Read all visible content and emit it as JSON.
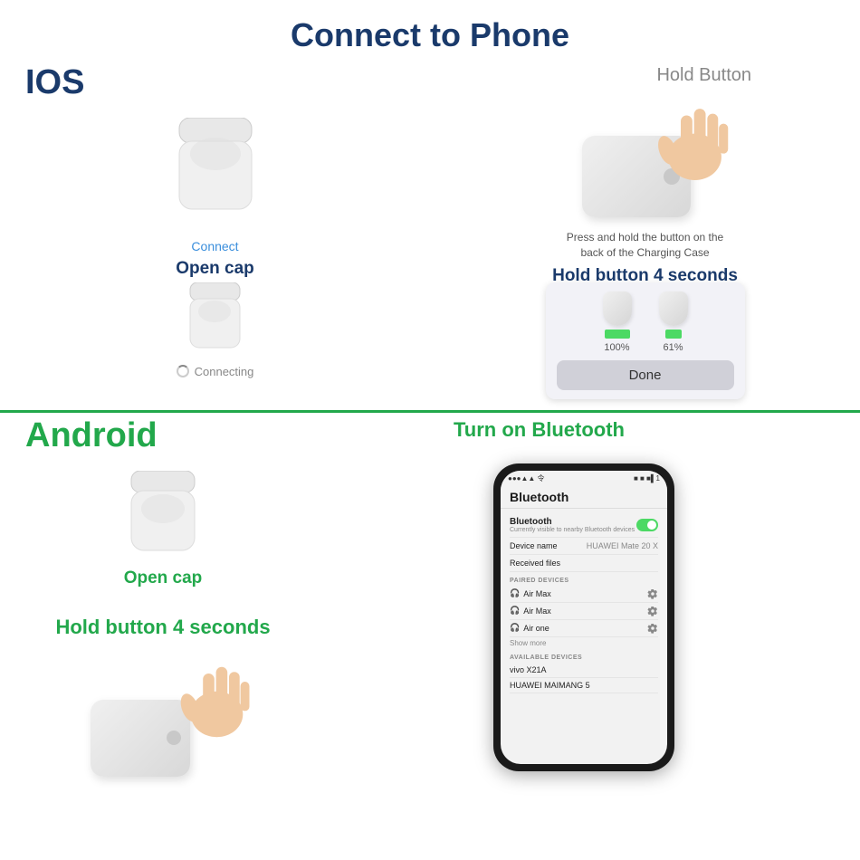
{
  "page": {
    "title": "Connect to Phone",
    "ios_label": "IOS",
    "android_label": "Android",
    "hold_button_label": "Hold Button",
    "turn_on_bt_label": "Turn on Bluetooth"
  },
  "ios": {
    "left_step": {
      "connect_label": "Connect",
      "step_label": "Open cap"
    },
    "right_step": {
      "press_description": "Press and hold the button on the\nback of the Charging Case",
      "step_label": "Hold button 4 seconds"
    },
    "bottom_left": {
      "connecting_label": "Connecting"
    },
    "bottom_right": {
      "battery_left_pct": "100%",
      "battery_right_pct": "61%",
      "done_btn": "Done"
    }
  },
  "android": {
    "open_cap_label": "Open cap",
    "hold_label": "Hold button 4 seconds",
    "phone": {
      "header": "Bluetooth",
      "bt_label": "Bluetooth",
      "bt_sublabel": "Currently visible to nearby Bluetooth devices",
      "device_name_label": "Device name",
      "device_name_value": "HUAWEI Mate 20 X",
      "received_files": "Received files",
      "paired_section_title": "PAIRED DEVICES",
      "devices": [
        {
          "name": "Air Max",
          "icon": "headphone"
        },
        {
          "name": "Air Max",
          "icon": "headphone"
        },
        {
          "name": "Air one",
          "icon": "headphone"
        }
      ],
      "show_more": "Show more",
      "available_section_title": "AVAILABLE DEVICES",
      "available_devices": [
        {
          "name": "vivo X21A"
        },
        {
          "name": "HUAWEI MAIMANG 5"
        }
      ]
    }
  }
}
